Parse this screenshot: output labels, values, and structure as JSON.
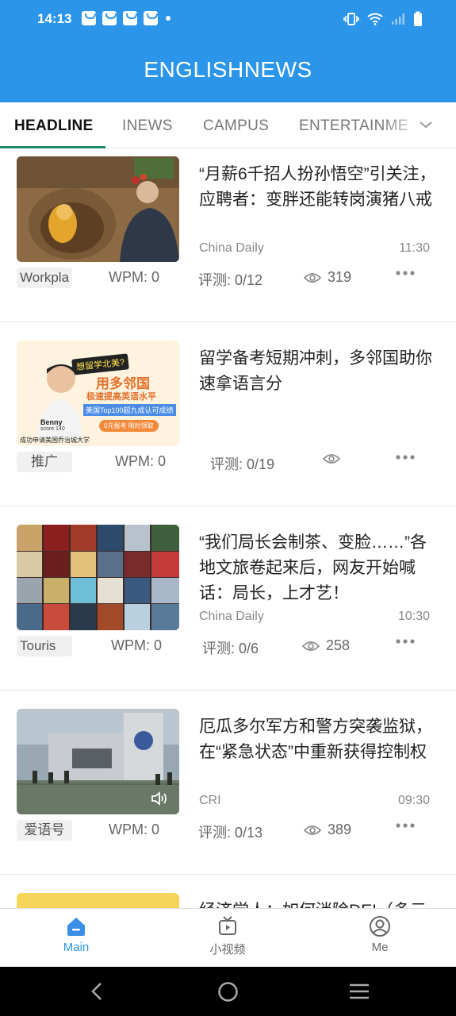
{
  "status_bar": {
    "time": "14:13"
  },
  "app_bar": {
    "title": "ENGLISHNEWS"
  },
  "tabs": [
    {
      "label": "HEADLINE"
    },
    {
      "label": "INEWS"
    },
    {
      "label": "CAMPUS"
    },
    {
      "label": "ENTERTAINME"
    }
  ],
  "cards": [
    {
      "title": "“月薪6千招人扮孙悟空”引关注，应聘者：变胖还能转岗演猪八戒",
      "source": "China Daily",
      "time": "11:30",
      "tag": "Workpla",
      "wpm": "WPM: 0",
      "review": "评测: 0/12",
      "views": "319",
      "thumb_icon": "photo-monkey-king-costume"
    },
    {
      "title": "留学备考短期冲刺，多邻国助你速拿语言分",
      "source": "",
      "time": "",
      "tag": "推广",
      "wpm": "WPM: 0",
      "review": "评测: 0/19",
      "views": "",
      "thumb_icon": "ad-duolingo-english-test",
      "ad_text": {
        "bubble": "想留学北美?",
        "headline_a": "用多邻国",
        "headline_b": "极速提高英语水平",
        "sub": "美国Top100超九成认可成绩",
        "pill": "0元报考 限时领取",
        "name": "Benny",
        "score": "score 140",
        "footer": "成功申请美国乔治城大学"
      }
    },
    {
      "title": "“我们局长会制茶、变脸……”各地文旅卷起来后，网友开始喊话：局长，上才艺！",
      "source": "China Daily",
      "time": "10:30",
      "tag": "Touris",
      "wpm": "WPM: 0",
      "review": "评测: 0/6",
      "views": "258",
      "thumb_icon": "collage-tourism-directors"
    },
    {
      "title": "厄瓜多尔军方和警方突袭监狱，在“紧急状态”中重新获得控制权",
      "source": "CRI",
      "time": "09:30",
      "tag": "爱语号",
      "wpm": "WPM: 0",
      "review": "评测: 0/13",
      "views": "389",
      "thumb_icon": "photo-prison-raid",
      "audio_icon": "speaker-icon"
    },
    {
      "title": "经济学人：如何消除DEI（多元",
      "thumb_icon": "thumb-yellow"
    }
  ],
  "bottom_nav": [
    {
      "label": "Main",
      "icon": "home-icon",
      "active": true
    },
    {
      "label": "小视频",
      "icon": "video-icon",
      "active": false
    },
    {
      "label": "Me",
      "icon": "profile-icon",
      "active": false
    }
  ],
  "colors": {
    "brand_blue": "#2b95e9",
    "tab_underline": "#1a8a6c",
    "muted_text": "#888888"
  }
}
